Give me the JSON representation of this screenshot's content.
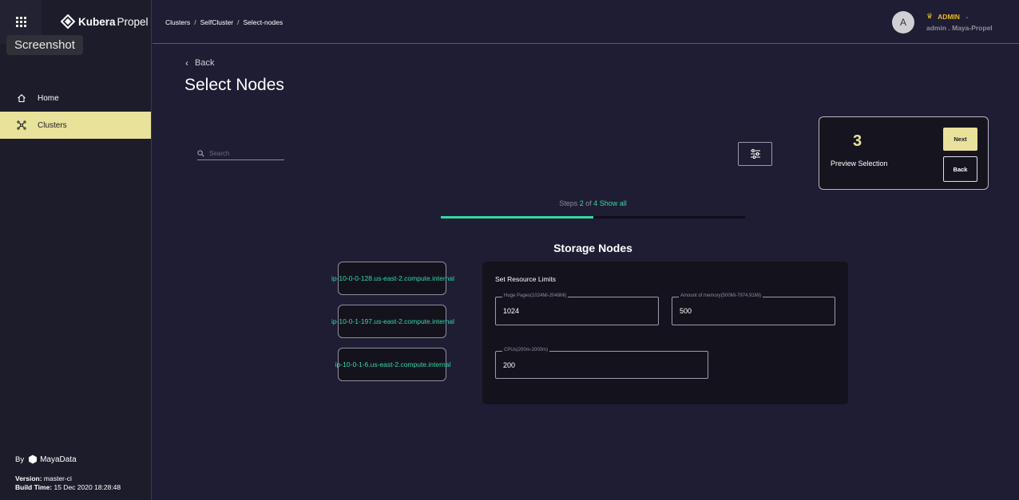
{
  "sidebar": {
    "logo_brand": "Kubera",
    "logo_product": "Propel",
    "tooltip": "Screenshot",
    "items": [
      {
        "label": "Home",
        "icon": "home-icon"
      },
      {
        "label": "Clusters",
        "icon": "clusters-icon"
      }
    ],
    "by_label": "By",
    "maker": "MayaData",
    "version_label": "Version:",
    "version_value": " master-ci",
    "build_label": "Build Time:",
    "build_value": " 15 Dec 2020 18:28:48"
  },
  "header": {
    "breadcrumbs": [
      "Clusters",
      "SelfCluster",
      "Select-nodes"
    ],
    "avatar_letter": "A",
    "role": "ADMIN",
    "user_sub": "admin . Maya-Propel"
  },
  "main": {
    "back_label": "Back",
    "title": "Select Nodes",
    "search_placeholder": "Search",
    "preview": {
      "count": "3",
      "label": "Preview Selection",
      "next_label": "Next",
      "back_label": "Back"
    },
    "steps": {
      "prefix": "Steps ",
      "current": "2",
      "of": " of ",
      "total": "4",
      "show_all": " Show all",
      "progress_fraction": 0.5
    },
    "section_title": "Storage Nodes",
    "nodes": [
      "ip-10-0-0-128.us-east-2.compute.internal",
      "ip-10-0-1-197.us-east-2.compute.internal",
      "ip-10-0-1-6.us-east-2.compute.internal"
    ],
    "limits": {
      "title": "Set Resource Limits",
      "huge_pages_label": "Huge Pages(1024Mi-2048Mi)",
      "huge_pages_value": "1024",
      "memory_label": "Amount of memory(500Mi-7974.91Mi)",
      "memory_value": "500",
      "cpus_label": "CPUs(200m-2000m)",
      "cpus_value": "200"
    }
  },
  "colors": {
    "accent": "#e9e29a",
    "success": "#35d9a5",
    "role": "#e8b923",
    "background": "#1f1d33"
  }
}
